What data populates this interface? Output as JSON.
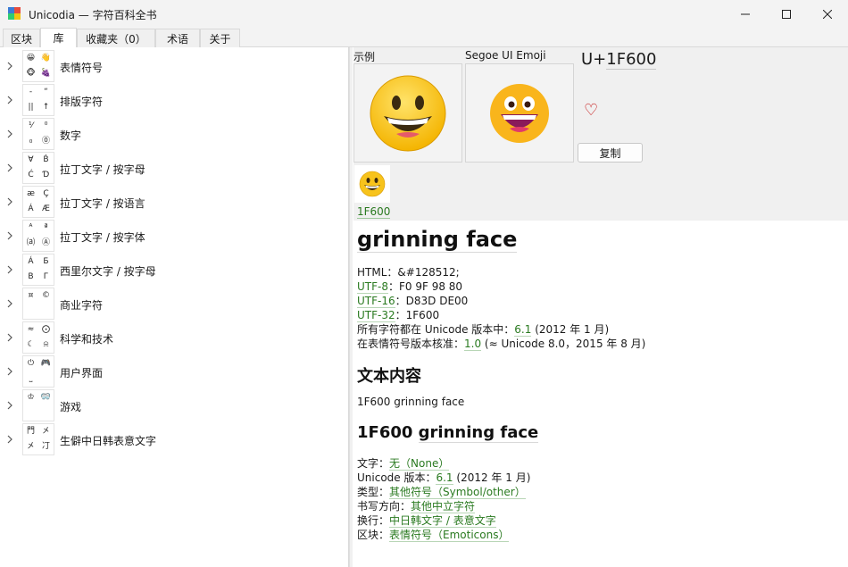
{
  "window": {
    "title": "Unicodia — 字符百科全书",
    "minimize_icon": "minimize-icon",
    "maximize_icon": "maximize-icon",
    "close_icon": "close-icon"
  },
  "tabs": [
    {
      "label": "区块"
    },
    {
      "label": "库"
    },
    {
      "label": "收藏夹（0）"
    },
    {
      "label": "术语"
    },
    {
      "label": "关于"
    }
  ],
  "categories": [
    {
      "label": "表情符号",
      "glyphs": [
        "😀",
        "👋",
        "🐵",
        "🍇"
      ]
    },
    {
      "label": "排版字符",
      "glyphs": [
        "-",
        "“",
        "||",
        "↑"
      ]
    },
    {
      "label": "数字",
      "glyphs": [
        "¹⁄",
        "⁰",
        "₀",
        "⓪"
      ]
    },
    {
      "label": "拉丁文字 / 按字母",
      "glyphs": [
        "Ɐ",
        "Ḃ",
        "Ć",
        "Ɗ"
      ]
    },
    {
      "label": "拉丁文字 / 按语言",
      "glyphs": [
        "æ",
        "Ç",
        "Á",
        "Æ"
      ]
    },
    {
      "label": "拉丁文字 / 按字体",
      "glyphs": [
        "ᴬ",
        "ª",
        "⒜",
        "Ⓐ"
      ]
    },
    {
      "label": "西里尔文字 / 按字母",
      "glyphs": [
        "Á",
        "Б",
        "В",
        "Г"
      ]
    },
    {
      "label": "商业字符",
      "glyphs": [
        "¤",
        "©",
        "",
        ""
      ]
    },
    {
      "label": "科学和技术",
      "glyphs": [
        "≈",
        "⨀",
        "☾",
        "⍾"
      ]
    },
    {
      "label": "用户界面",
      "glyphs": [
        "⏻",
        "🎮",
        "⎵",
        ""
      ]
    },
    {
      "label": "游戏",
      "glyphs": [
        "♔",
        "🥽",
        "",
        ""
      ]
    },
    {
      "label": "生僻中日韩表意文字",
      "glyphs": [
        "門",
        "㐅",
        "㐅",
        "㓅"
      ]
    }
  ],
  "preview": {
    "sample_label": "示例",
    "font_label": "Segoe UI Emoji",
    "glyph": "😀",
    "codepoint_prefix": "U+",
    "codepoint": "1F600",
    "favorite_icon": "heart-outline-icon",
    "heart_glyph": "♡",
    "copy_label": "复制",
    "variant_code": "1F600"
  },
  "details": {
    "name": "grinning face",
    "html_label": "HTML：",
    "html_value": "&#128512;",
    "utf8_label": "UTF-8",
    "utf8_value": "F0 9F 98 80",
    "utf16_label": "UTF-16",
    "utf16_value": "D83D DE00",
    "utf32_label": "UTF-32",
    "utf32_value": "1F600",
    "version_prefix": "所有字符都在 Unicode 版本中：",
    "version_link": "6.1",
    "version_suffix": " (2012 年 1 月)",
    "emoji_prefix": "在表情符号版本核准：",
    "emoji_link": "1.0",
    "emoji_suffix": " (≈ Unicode 8.0，2015 年 8 月)",
    "text_content_heading": "文本内容",
    "text_content_value": "1F600 grinning face",
    "section_heading_code": "1F600 ",
    "section_heading_name": "grinning face",
    "script_label": "文字：",
    "script_value": "无（None）",
    "uversion_label": "Unicode 版本：",
    "uversion_link": "6.1",
    "uversion_suffix": " (2012 年 1 月)",
    "type_label": "类型：",
    "type_value": "其他符号（Symbol/other）",
    "direction_label": "书写方向：",
    "direction_value": "其他中立字符",
    "linebreak_label": "换行：",
    "linebreak_value": "中日韩文字 / 表意文字",
    "block_label": "区块：",
    "block_value": "表情符号（Emoticons）"
  },
  "colors": {
    "link": "#2a7a20",
    "heart": "#c20000",
    "panel_bg": "#f0f0f0"
  }
}
